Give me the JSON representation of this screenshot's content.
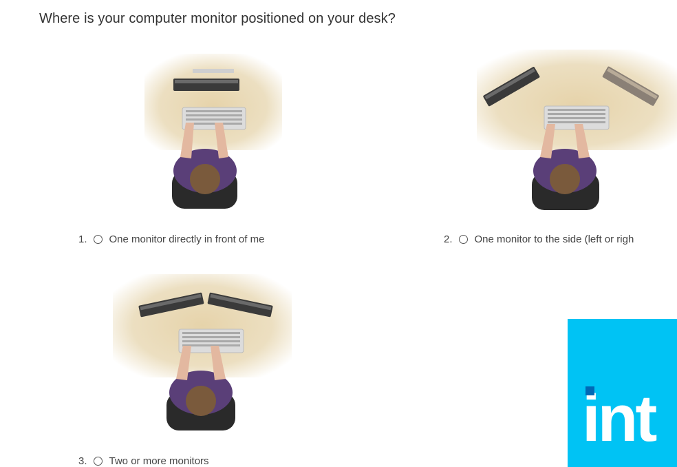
{
  "question": "Where is your computer monitor positioned on your desk?",
  "options": [
    {
      "number": "1.",
      "label": "One monitor directly in front of me",
      "illustration": "single-monitor-front-icon"
    },
    {
      "number": "2.",
      "label": "One monitor to the side (left or righ",
      "illustration": "monitor-to-side-icon"
    },
    {
      "number": "3.",
      "label": "Two or more monitors",
      "illustration": "multiple-monitors-icon"
    }
  ],
  "logo": {
    "text": "int",
    "background": "#00c3f4",
    "dot_color": "#0068b5"
  },
  "colors": {
    "desk": "#e8d8b4",
    "shirt": "#5a3f78",
    "hair": "#7a5a3c",
    "chair": "#2a2a2a",
    "monitor": "#3a3a3a"
  }
}
